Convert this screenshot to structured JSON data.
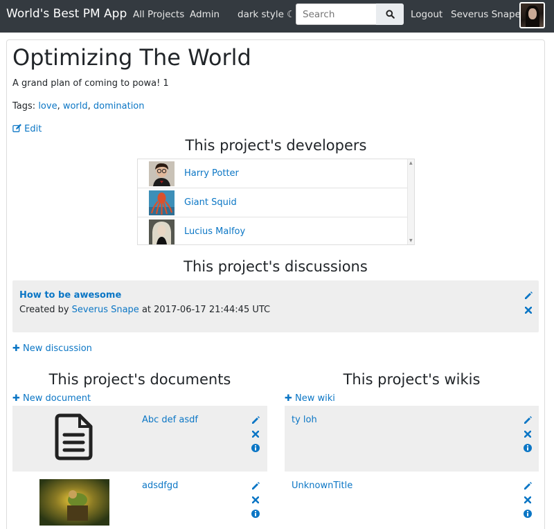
{
  "navbar": {
    "brand": "World's Best PM App",
    "links": {
      "all_projects": "All Projects",
      "admin": "Admin",
      "dark_style": "dark style ☾",
      "logout": "Logout",
      "user": "Severus Snape"
    },
    "search": {
      "placeholder": "Search"
    }
  },
  "project": {
    "title": "Optimizing The World",
    "description": "A grand plan of coming to powa! 1",
    "tags_label": "Tags:",
    "tags": [
      "love",
      "world",
      "domination"
    ],
    "edit_label": "Edit"
  },
  "developers": {
    "heading": "This project's developers",
    "items": [
      {
        "name": "Harry Potter"
      },
      {
        "name": "Giant Squid"
      },
      {
        "name": "Lucius Malfoy"
      }
    ]
  },
  "discussions": {
    "heading": "This project's discussions",
    "items": [
      {
        "title": "How to be awesome",
        "created_prefix": "Created by",
        "author": "Severus Snape",
        "at_text": "at 2017-06-17 21:44:45 UTC"
      }
    ],
    "new_label": "New discussion"
  },
  "documents": {
    "heading": "This project's documents",
    "new_label": "New document",
    "items": [
      {
        "name": "Abc def asdf",
        "thumb": "document-icon"
      },
      {
        "name": "adsdfgd",
        "thumb": "image-thumbnail"
      }
    ]
  },
  "wikis": {
    "heading": "This project's wikis",
    "new_label": "New wiki",
    "items": [
      {
        "name": "ty loh"
      },
      {
        "name": "UnknownTitle"
      }
    ]
  },
  "colors": {
    "link": "#0b76c5",
    "navbar": "#343a40",
    "panel": "#eeeeee"
  }
}
